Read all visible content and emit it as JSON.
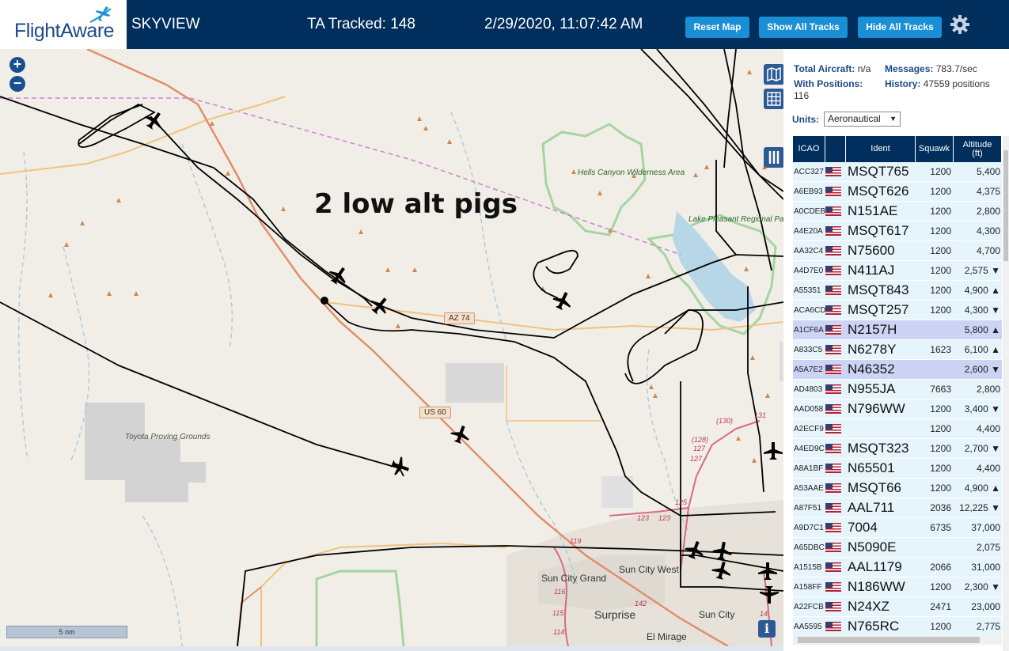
{
  "header": {
    "logo_text": "FlightAware",
    "app_name": "SKYVIEW",
    "tracked": "TA Tracked: 148",
    "datetime": "2/29/2020, 11:07:42 AM",
    "buttons": {
      "reset": "Reset Map",
      "show": "Show All Tracks",
      "hide": "Hide All Tracks"
    },
    "settings_icon": "gear-icon"
  },
  "map": {
    "annotation": "2 low alt pigs",
    "zoom_in": "+",
    "zoom_out": "−",
    "scale": "5 nm",
    "info": "i",
    "road_labels": {
      "az74": "AZ 74",
      "us60": "US 60"
    },
    "places": {
      "hells_canyon": "Hells Canyon Wilderness Area",
      "lake_pleasant": "Lake Pleasant Regional Park",
      "toyota": "Toyota Proving Grounds",
      "sun_city_west": "Sun City West",
      "sun_city_grand": "Sun City Grand",
      "surprise": "Surprise",
      "sun_city": "Sun City",
      "el_mirage": "El Mirage"
    },
    "route_numbers": {
      "r119": "119",
      "r116": "116",
      "r115": "115",
      "r114": "114",
      "r142": "142",
      "r123a": "123",
      "r123b": "123",
      "r125": "125",
      "r127a": "127",
      "r127b": "127",
      "r128": "(128)",
      "r130": "(130)",
      "r131": "131",
      "r14": "14"
    }
  },
  "stats": {
    "total_label": "Total Aircraft:",
    "total_value": "n/a",
    "messages_label": "Messages:",
    "messages_value": "783.7/sec",
    "positions_label": "With Positions:",
    "positions_value": "116",
    "history_label": "History:",
    "history_value": "47559 positions"
  },
  "units": {
    "label": "Units:",
    "selected": "Aeronautical"
  },
  "table": {
    "headers": {
      "icao": "ICAO",
      "ident": "Ident",
      "squawk": "Squawk",
      "altitude": "Altitude (ft)"
    },
    "rows": [
      {
        "icao": "ACC327",
        "ident": "MSQT765",
        "squawk": "1200",
        "alt": "5,400"
      },
      {
        "icao": "A6EB93",
        "ident": "MSQT626",
        "squawk": "1200",
        "alt": "4,375"
      },
      {
        "icao": "A0CDEB",
        "ident": "N151AE",
        "squawk": "1200",
        "alt": "2,800"
      },
      {
        "icao": "A4E20A",
        "ident": "MSQT617",
        "squawk": "1200",
        "alt": "4,300"
      },
      {
        "icao": "AA32C4",
        "ident": "N75600",
        "squawk": "1200",
        "alt": "4,700"
      },
      {
        "icao": "A4D7E0",
        "ident": "N411AJ",
        "squawk": "1200",
        "alt": "2,575 ▼"
      },
      {
        "icao": "A55351",
        "ident": "MSQT843",
        "squawk": "1200",
        "alt": "4,900 ▲"
      },
      {
        "icao": "ACA6CD",
        "ident": "MSQT257",
        "squawk": "1200",
        "alt": "4,300 ▼"
      },
      {
        "icao": "A1CF6A",
        "ident": "N2157H",
        "squawk": "",
        "alt": "5,800 ▲"
      },
      {
        "icao": "A833C5",
        "ident": "N6278Y",
        "squawk": "1623",
        "alt": "6,100 ▲"
      },
      {
        "icao": "A5A7E2",
        "ident": "N46352",
        "squawk": "",
        "alt": "2,600 ▼"
      },
      {
        "icao": "AD4803",
        "ident": "N955JA",
        "squawk": "7663",
        "alt": "2,800"
      },
      {
        "icao": "AAD058",
        "ident": "N796WW",
        "squawk": "1200",
        "alt": "3,400 ▼"
      },
      {
        "icao": "A2ECF9",
        "ident": "",
        "squawk": "1200",
        "alt": "4,400"
      },
      {
        "icao": "A4ED9C",
        "ident": "MSQT323",
        "squawk": "1200",
        "alt": "2,700 ▼"
      },
      {
        "icao": "A8A1BF",
        "ident": "N65501",
        "squawk": "1200",
        "alt": "4,400"
      },
      {
        "icao": "A53AAE",
        "ident": "MSQT66",
        "squawk": "1200",
        "alt": "4,900 ▲"
      },
      {
        "icao": "A87F51",
        "ident": "AAL711",
        "squawk": "2036",
        "alt": "12,225 ▼"
      },
      {
        "icao": "A9D7C1",
        "ident": "7004",
        "squawk": "6735",
        "alt": "37,000"
      },
      {
        "icao": "A65DBC",
        "ident": "N5090E",
        "squawk": "",
        "alt": "2,075"
      },
      {
        "icao": "A1515B",
        "ident": "AAL1179",
        "squawk": "2066",
        "alt": "31,000"
      },
      {
        "icao": "A158FF",
        "ident": "N186WW",
        "squawk": "1200",
        "alt": "2,300 ▼"
      },
      {
        "icao": "A22FCB",
        "ident": "N24XZ",
        "squawk": "2471",
        "alt": "23,000"
      },
      {
        "icao": "AA5595",
        "ident": "N765RC",
        "squawk": "1200",
        "alt": "2,775"
      }
    ]
  },
  "colors": {
    "header_bg": "#002f5d",
    "button": "#1a8fd6",
    "row_bg": "#e6f4fb",
    "row_selected": "#cdd3f5"
  }
}
